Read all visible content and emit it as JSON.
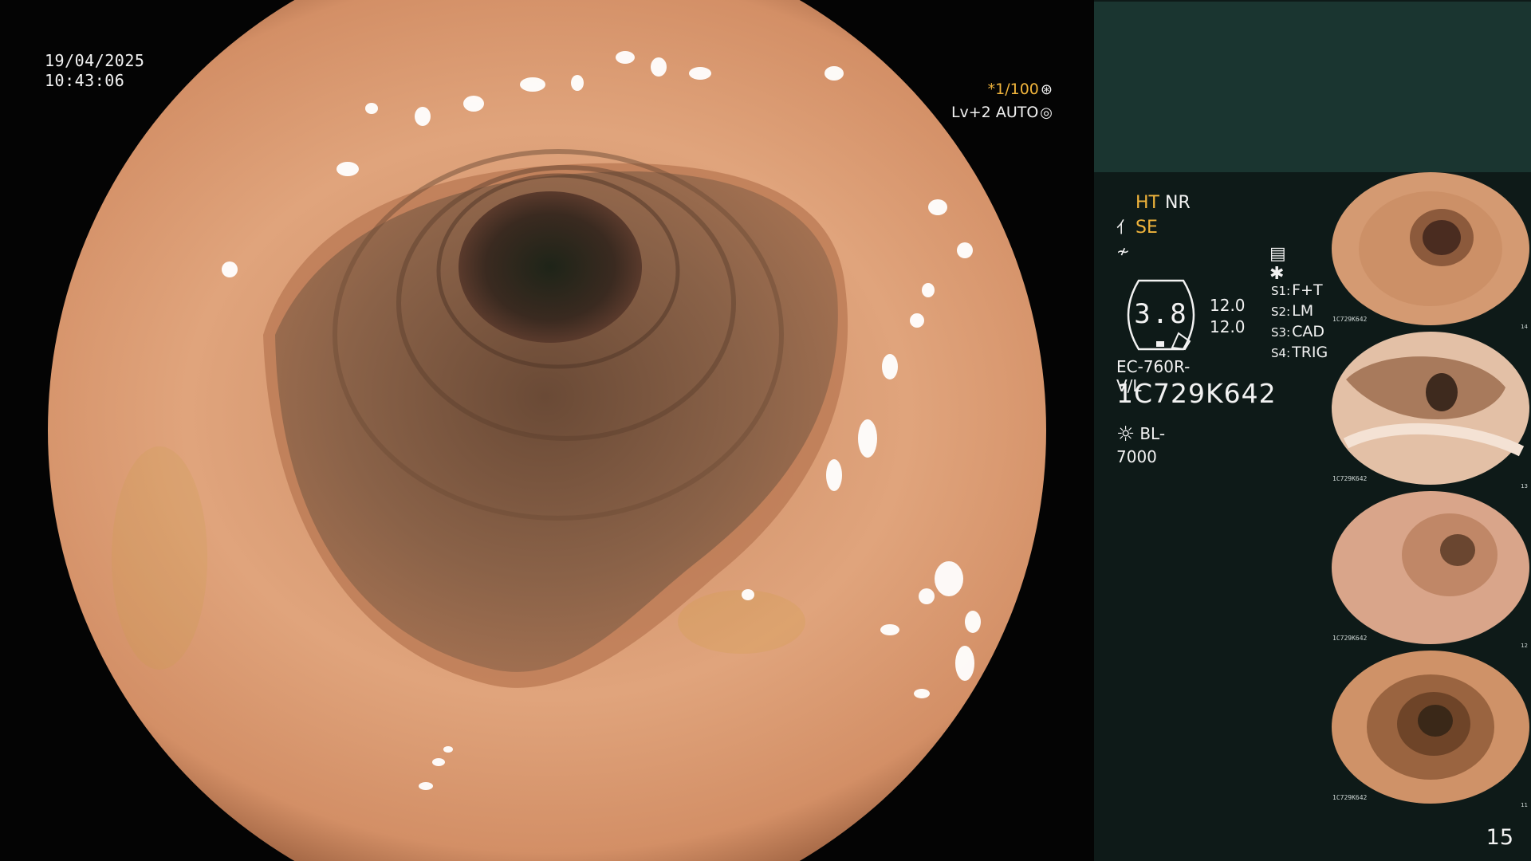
{
  "datetime": {
    "date": "19/04/2025",
    "time": "10:43:06"
  },
  "exposure": {
    "shutter": "*1/100",
    "shutter_icon": "aperture-icon",
    "level": "Lv+2 AUTO",
    "level_icon": "auto-iris-icon"
  },
  "panel": {
    "modes": [
      {
        "icon": "",
        "label_accent": "HT",
        "label": "NR"
      },
      {
        "icon": "structure-enhance-icon",
        "label_accent": "SE",
        "label": ""
      },
      {
        "icon": "color-tone-icon",
        "label_accent": "",
        "label": ""
      }
    ],
    "mid_icons": [
      "menu-list-icon",
      "asterisk-icon"
    ],
    "dial_value": "3.8",
    "gains": [
      "12.0",
      "12.0"
    ],
    "switches": [
      {
        "key": "S1:",
        "value": "F+T"
      },
      {
        "key": "S2:",
        "value": "LM"
      },
      {
        "key": "S3:",
        "value": "CAD"
      },
      {
        "key": "S4:",
        "value": "TRIG"
      }
    ],
    "scope_model": "EC-760R-V/L",
    "serial": "1C729K642",
    "light_icon": "lamp-icon",
    "light_source": "BL-7000"
  },
  "thumbnails": [
    {
      "caption": "1C729K642",
      "index": "14"
    },
    {
      "caption": "1C729K642",
      "index": "13"
    },
    {
      "caption": "1C729K642",
      "index": "12"
    },
    {
      "caption": "1C729K642",
      "index": "11"
    }
  ],
  "page_number": "15",
  "colors": {
    "accent": "#f0b43c",
    "panel_bg": "#0e1a18",
    "panel_header": "#1a3530",
    "mucosa": "#d99a72"
  }
}
